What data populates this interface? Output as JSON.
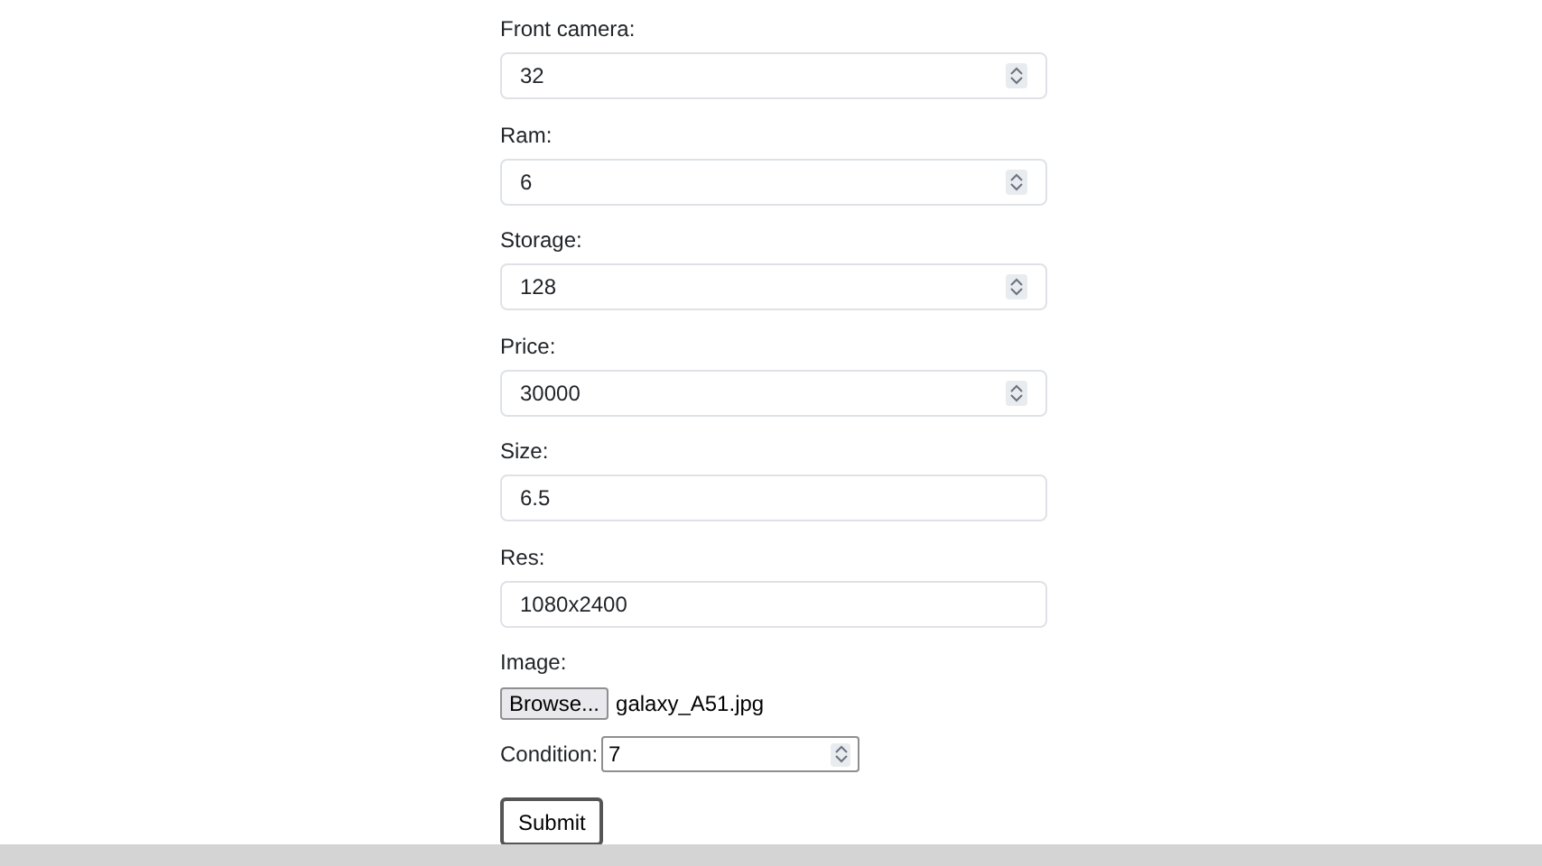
{
  "fields": [
    {
      "label": "Front camera:",
      "value": "32",
      "kind": "number"
    },
    {
      "label": "Ram:",
      "value": "6",
      "kind": "number"
    },
    {
      "label": "Storage:",
      "value": "128",
      "kind": "number"
    },
    {
      "label": "Price:",
      "value": "30000",
      "kind": "number"
    },
    {
      "label": "Size:",
      "value": "6.5",
      "kind": "text"
    },
    {
      "label": "Res:",
      "value": "1080x2400",
      "kind": "text"
    }
  ],
  "image": {
    "label": "Image:",
    "button": "Browse...",
    "filename": "galaxy_A51.jpg"
  },
  "condition": {
    "label": "Condition:",
    "value": "7"
  },
  "submit": "Submit"
}
